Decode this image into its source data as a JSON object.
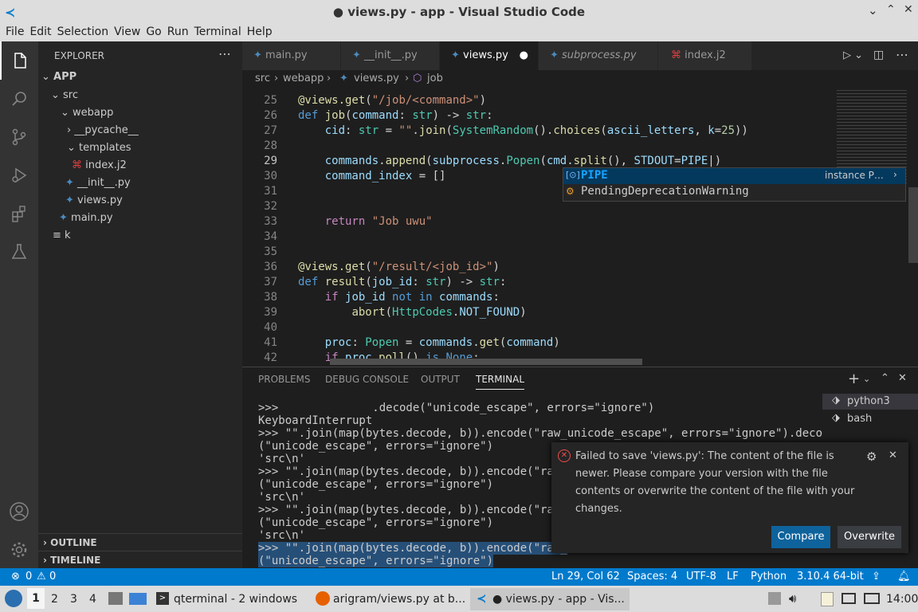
{
  "window": {
    "title": "● views.py - app - Visual Studio Code"
  },
  "menu": [
    "File",
    "Edit",
    "Selection",
    "View",
    "Go",
    "Run",
    "Terminal",
    "Help"
  ],
  "explorer": {
    "header": "EXPLORER",
    "root": "APP",
    "items": [
      "src",
      "webapp",
      "__pycache__",
      "templates",
      "index.j2",
      "__init__.py",
      "views.py",
      "main.py",
      "k"
    ],
    "outline": "OUTLINE",
    "timeline": "TIMELINE"
  },
  "tabs": [
    "main.py",
    "__init__.py",
    "views.py",
    "subprocess.py",
    "index.j2"
  ],
  "breadcrumb": {
    "src": "src",
    "webapp": "webapp",
    "file": "views.py",
    "symbol": "job"
  },
  "editor": {
    "line_numbers": [
      "25",
      "26",
      "27",
      "28",
      "29",
      "30",
      "31",
      "32",
      "33",
      "34",
      "35",
      "36",
      "37",
      "38",
      "39",
      "40",
      "41",
      "42"
    ]
  },
  "suggest": {
    "item1": "PIPE",
    "item1_detail": "instance P…",
    "item2": "PendingDeprecationWarning"
  },
  "panel": {
    "tabs": [
      "PROBLEMS",
      "DEBUG CONSOLE",
      "OUTPUT",
      "TERMINAL"
    ],
    "terminal_list": [
      "python3",
      "bash"
    ]
  },
  "terminal_lines": [
    ">>>              .decode(\"unicode_escape\", errors=\"ignore\")",
    "KeyboardInterrupt",
    ">>> \"\".join(map(bytes.decode, b)).encode(\"raw_unicode_escape\", errors=\"ignore\").decode",
    "(\"unicode_escape\", errors=\"ignore\")",
    "'src\\n'",
    ">>> \"\".join(map(bytes.decode, b)).encode(\"raw_",
    "(\"unicode_escape\", errors=\"ignore\")",
    "'src\\n'",
    ">>> \"\".join(map(bytes.decode, b)).encode(\"raw_",
    "(\"unicode_escape\", errors=\"ignore\")",
    "'src\\n'",
    ">>> \"\".join(map(bytes.decode, b)).encode(\"raw_",
    "(\"unicode_escape\", errors=\"ignore\")"
  ],
  "notification": {
    "message": "Failed to save 'views.py': The content of the file is newer. Please compare your version with the file contents or overwrite the content of the file with your changes.",
    "compare": "Compare",
    "overwrite": "Overwrite"
  },
  "status": {
    "errors": "0",
    "warnings": "0",
    "position": "Ln 29, Col 62",
    "spaces": "Spaces: 4",
    "encoding": "UTF-8",
    "eol": "LF",
    "language": "Python",
    "interpreter": "3.10.4 64-bit"
  },
  "taskbar": {
    "workspaces": [
      "1",
      "2",
      "3",
      "4"
    ],
    "qterminal": "qterminal - 2 windows",
    "firefox": "arigram/views.py at b...",
    "vscode": "● views.py - app - Vis...",
    "clock": "14:00"
  },
  "colors": {
    "accent": "#007acc",
    "sidebar": "#252526",
    "editor": "#1e1e1e",
    "activity": "#333333"
  }
}
